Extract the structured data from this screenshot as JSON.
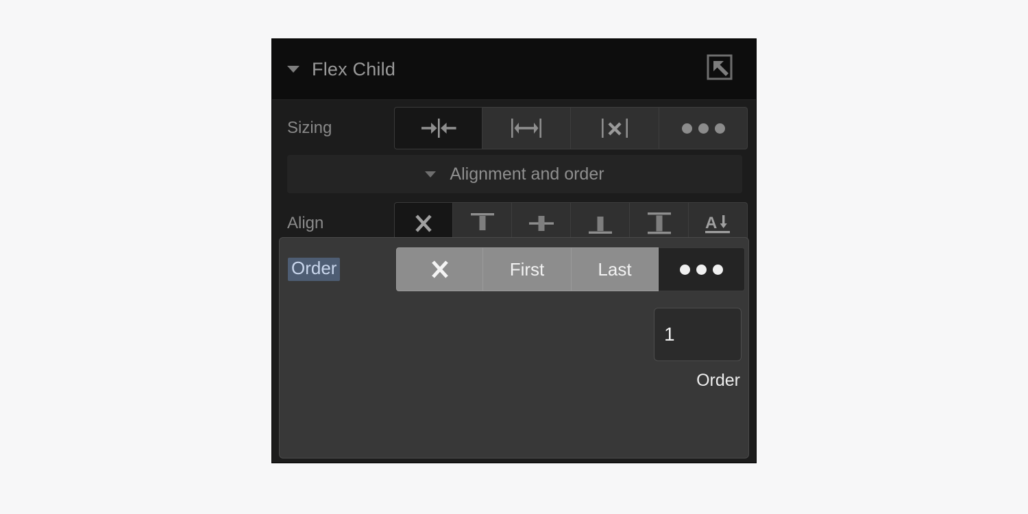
{
  "panel": {
    "title": "Flex Child",
    "collapse_caret": "caret-down-icon",
    "parent_select_icon": "select-parent-icon"
  },
  "sizing": {
    "label": "Sizing",
    "options": [
      {
        "name": "shrink",
        "icon": "shrink-icon",
        "selected": true
      },
      {
        "name": "grow",
        "icon": "grow-icon",
        "selected": false
      },
      {
        "name": "none",
        "icon": "no-sizing-icon",
        "selected": false
      },
      {
        "name": "more",
        "icon": "ellipsis-icon",
        "selected": false
      }
    ]
  },
  "subsection": {
    "label": "Alignment and order",
    "caret": "caret-down-icon",
    "expanded": true
  },
  "align": {
    "label": "Align",
    "options": [
      {
        "name": "auto",
        "icon": "x-icon",
        "selected": true
      },
      {
        "name": "start",
        "icon": "align-start-icon",
        "selected": false
      },
      {
        "name": "center",
        "icon": "align-center-icon",
        "selected": false
      },
      {
        "name": "end",
        "icon": "align-end-icon",
        "selected": false
      },
      {
        "name": "stretch",
        "icon": "align-stretch-icon",
        "selected": false
      },
      {
        "name": "baseline",
        "icon": "align-baseline-icon",
        "selected": false
      }
    ]
  },
  "order": {
    "label": "Order",
    "label_selected": true,
    "options": [
      {
        "label": "",
        "name": "auto",
        "icon": "x-icon",
        "selected": false
      },
      {
        "label": "First",
        "name": "first",
        "icon": "",
        "selected": false
      },
      {
        "label": "Last",
        "name": "last",
        "icon": "",
        "selected": false
      },
      {
        "label": "",
        "name": "custom",
        "icon": "ellipsis-icon",
        "selected": true
      }
    ],
    "value": "1",
    "value_caption": "Order"
  },
  "colors": {
    "page_background": "#f7f7f8",
    "panel_background": "#1c1c1c",
    "header_background": "#0d0d0d",
    "highlight_background": "#383838",
    "selection_blue": "#4e5d73",
    "selection_text": "#c9d6ec",
    "button_light": "#8d8d8d",
    "text_muted": "#8a8a8a"
  }
}
